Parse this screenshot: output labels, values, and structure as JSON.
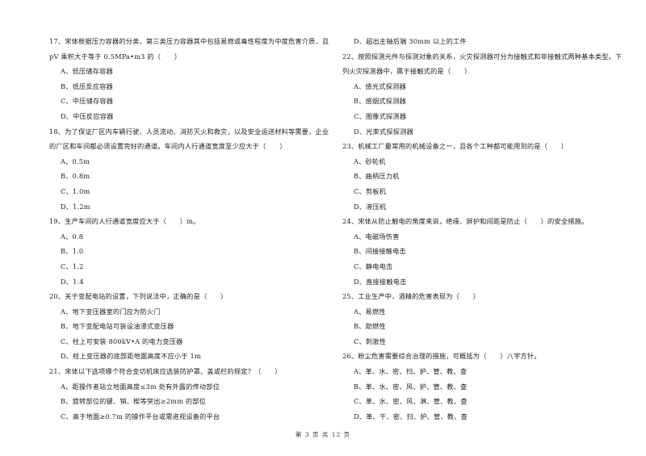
{
  "left_column": {
    "q17": {
      "stem_lines": [
        "17、宋体根据压力容器的分类，第三类压力容器其中包括易燃或毒性程度为中度危害介质，且",
        "pV 乘积大于等于 0.5MPa•m3 的（　　）"
      ],
      "options": [
        "A、低压储存容器",
        "B、低压反应容器",
        "C、中压储存容器",
        "D、中压反应容器"
      ]
    },
    "q18": {
      "stem_lines": [
        "18、为了保证厂区内车辆行驶、人员流动、消防灭火和救灾，以及安全运送材料等需要，企业",
        "的厂区和车间都必须设置完好的通道。车间内人行通道宽度至少应大于（　　）"
      ],
      "options": [
        "A、0.5m",
        "B、0.8m",
        "C、1.0m",
        "D、1.2m"
      ]
    },
    "q19": {
      "stem_lines": [
        "19、生产车间的人行通道宽度应大于（　　）m。"
      ],
      "options": [
        "A、0.8",
        "B、1.0",
        "C、1.2",
        "D、1.4"
      ]
    },
    "q20": {
      "stem_lines": [
        "20、关于变配电站的设置，下列说法中，正确的是（　　）"
      ],
      "options": [
        "A、地下变压器室的门应为防火门",
        "B、地下变配电站可装设油浸式变压器",
        "C、柱上可安装 800kV•A 的电力变压器",
        "D、柱上变压器的底部距地面高度不应小于 1m"
      ]
    },
    "q21": {
      "stem_lines": [
        "21、宋体以下选项哪个符合金切机床应选装防护罩、盖或栏的规定？（　　）"
      ],
      "options": [
        "A、距操作者站立地面高度≤3m 处有外露的传动部位",
        "B、旋转部位的键、销、楔等突出≥2mm 的部位",
        "C、高于地面≥0.7m 的操作平台或需进视设备的平台"
      ]
    }
  },
  "right_column": {
    "q21_cont": {
      "options": [
        "D、超出主轴后端 30mm 以上的工件"
      ]
    },
    "q22": {
      "stem_lines": [
        "22、按照探测元件与探测对象的关系，火灾探测器可分为接触式和非接触式两种基本类型。下",
        "列火灾探测器中，属于接触式的是（　　）"
      ],
      "options": [
        "A、感光式探测器",
        "B、感烟式探测器",
        "C、图像式探测器",
        "D、光束式探探测器"
      ]
    },
    "q23": {
      "stem_lines": [
        "23、机械工厂最常用的机械设备之一，且各个工种都可能用到的是（　　）"
      ],
      "options": [
        "A、砂轮机",
        "B、曲柄压力机",
        "C、剪板机",
        "D、液压机"
      ]
    },
    "q24": {
      "stem_lines": [
        "24、宋体从防止触电的角度来说，绝缘、屏护和间距是防止（　　）的安全措施。"
      ],
      "options": [
        "A、电磁场伤害",
        "B、间接接触电击",
        "C、静电电击",
        "D、直接接触电击"
      ]
    },
    "q25": {
      "stem_lines": [
        "25、工业生产中，酒精的危害表现为（　　）"
      ],
      "options": [
        "A、易燃性",
        "B、助燃性",
        "C、刺激性"
      ]
    },
    "q26": {
      "stem_lines": [
        "26、粉尘危害需要综合治理的措施，可概括为（　　）八字方针。"
      ],
      "options": [
        "A、革、水、密、扫、护、管、教、查",
        "B、革、水、密、风、护、管、教、查",
        "C、革、水、密、风、淋、管、教、查",
        "D、革、干、密、扫、护、管、教、查"
      ]
    }
  },
  "footer": {
    "page_label": "第 3 页 共 12 页"
  }
}
